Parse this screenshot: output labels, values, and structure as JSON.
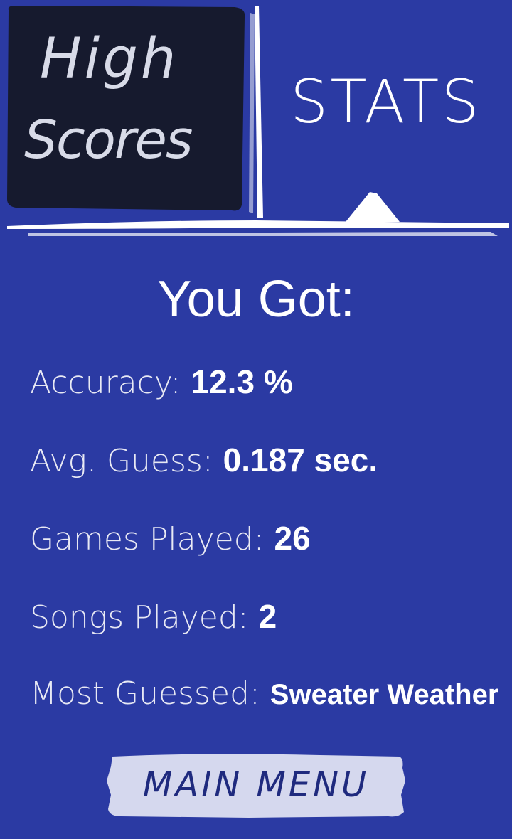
{
  "tabs": {
    "high_scores_line1": "High",
    "high_scores_line2": "Scores",
    "stats_label": "STATS"
  },
  "heading": "You Got:",
  "stats": [
    {
      "label": "Accuracy:",
      "value": "12.3 %"
    },
    {
      "label": "Avg. Guess:",
      "value": "0.187 sec."
    },
    {
      "label": "Games Played:",
      "value": "26"
    },
    {
      "label": "Songs Played:",
      "value": "2"
    },
    {
      "label": "Most Guessed:",
      "value": "Sweater Weather"
    }
  ],
  "main_menu_label": "MAIN MENU",
  "colors": {
    "background": "#2b3aa3",
    "inactive_tab": "#161a2e",
    "button_bg": "#d5d8ee",
    "text": "#ffffff"
  }
}
